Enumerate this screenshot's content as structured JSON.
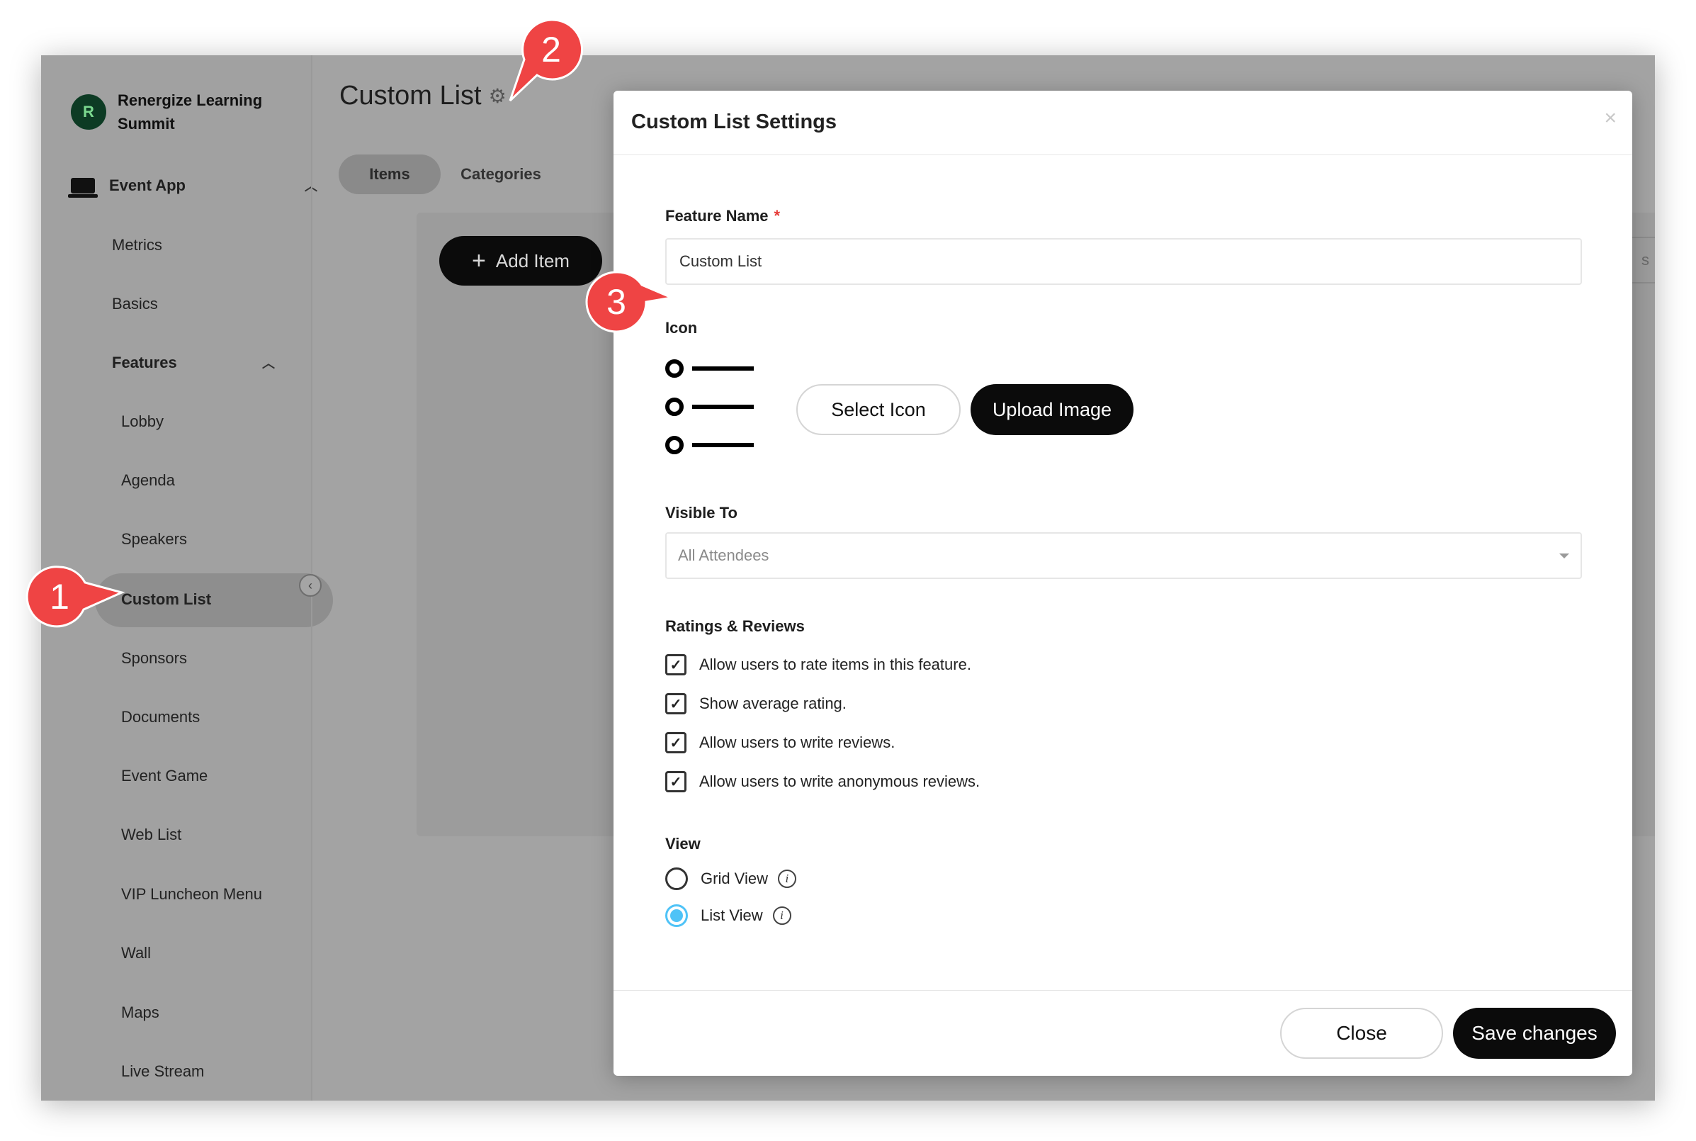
{
  "sidebar": {
    "brand_name": "Renergize Learning Summit",
    "event_app_label": "Event App",
    "top_items": [
      "Metrics",
      "Basics"
    ],
    "features_label": "Features",
    "features": [
      "Lobby",
      "Agenda",
      "Speakers",
      "Custom List",
      "Sponsors",
      "Documents",
      "Event Game",
      "Web List",
      "VIP Luncheon Menu",
      "Wall",
      "Maps",
      "Live Stream"
    ],
    "active_item": "Custom List"
  },
  "main": {
    "page_title": "Custom List",
    "tabs": [
      "Items",
      "Categories"
    ],
    "active_tab": "Items",
    "add_item_label": "Add Item",
    "right_hint_text": "s"
  },
  "modal": {
    "title": "Custom List Settings",
    "close_icon": "×",
    "feature_name_label": "Feature Name",
    "required_mark": "*",
    "feature_name_value": "Custom List",
    "icon_label": "Icon",
    "select_icon_label": "Select Icon",
    "upload_image_label": "Upload Image",
    "visible_to_label": "Visible To",
    "visible_to_value": "All Attendees",
    "ratings_label": "Ratings & Reviews",
    "checkboxes": [
      {
        "label": "Allow users to rate items in this feature.",
        "checked": true
      },
      {
        "label": "Show average rating.",
        "checked": true
      },
      {
        "label": "Allow users to write reviews.",
        "checked": true
      },
      {
        "label": "Allow users to write anonymous reviews.",
        "checked": true
      }
    ],
    "view_label": "View",
    "view_options": [
      {
        "label": "Grid View",
        "selected": false
      },
      {
        "label": "List View",
        "selected": true
      }
    ],
    "close_button": "Close",
    "save_button": "Save changes"
  },
  "callouts": [
    "1",
    "2",
    "3"
  ],
  "colors": {
    "callout": "#ef4444",
    "radio_selected": "#4fc3f7",
    "required": "#e53935",
    "overlay": "#a3a3a3"
  }
}
